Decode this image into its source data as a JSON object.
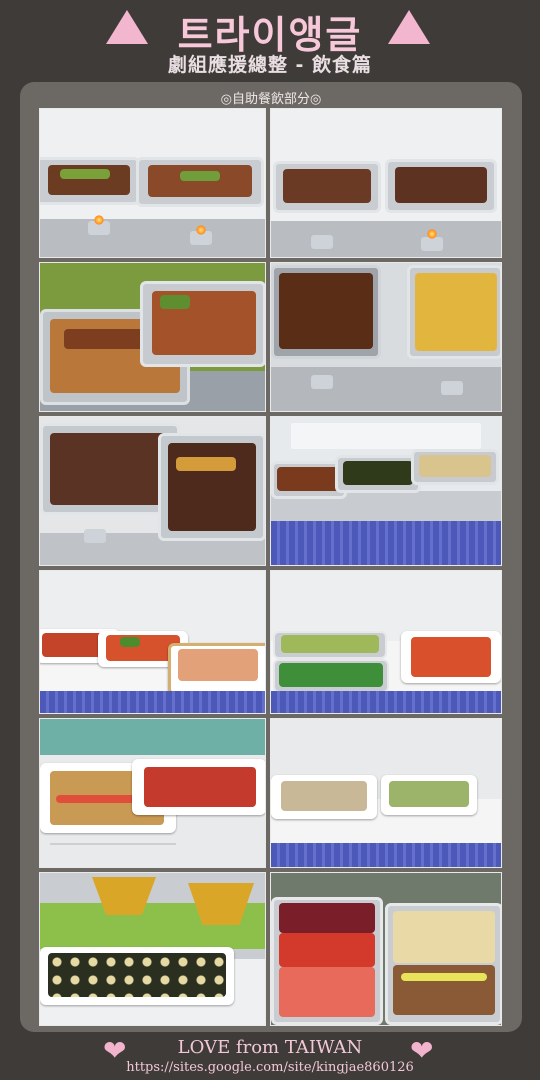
{
  "header": {
    "title": "트라이앵글",
    "subtitle": "劇組應援總整 - 飲食篇",
    "accent_color": "#f3b6cf"
  },
  "panel": {
    "section_label": "◎自助餐飲部分◎"
  },
  "photos": [
    {
      "name": "chafing-dishes-with-burners-1"
    },
    {
      "name": "chafing-dishes-with-burners-2"
    },
    {
      "name": "chafing-dishes-green-wall"
    },
    {
      "name": "chafing-dishes-meat-and-potato"
    },
    {
      "name": "chafing-dishes-sliced-meat"
    },
    {
      "name": "buffet-line-blue-skirt"
    },
    {
      "name": "platters-on-counter-1"
    },
    {
      "name": "platters-vegetables"
    },
    {
      "name": "platters-sandwiches"
    },
    {
      "name": "platters-on-counter-2"
    },
    {
      "name": "kimbap-and-bowls"
    },
    {
      "name": "fruit-and-dessert-trays"
    }
  ],
  "footer": {
    "heart_icon": "heart-icon",
    "title": "LOVE from TAIWAN",
    "url": "https://sites.google.com/site/kingjae860126"
  }
}
